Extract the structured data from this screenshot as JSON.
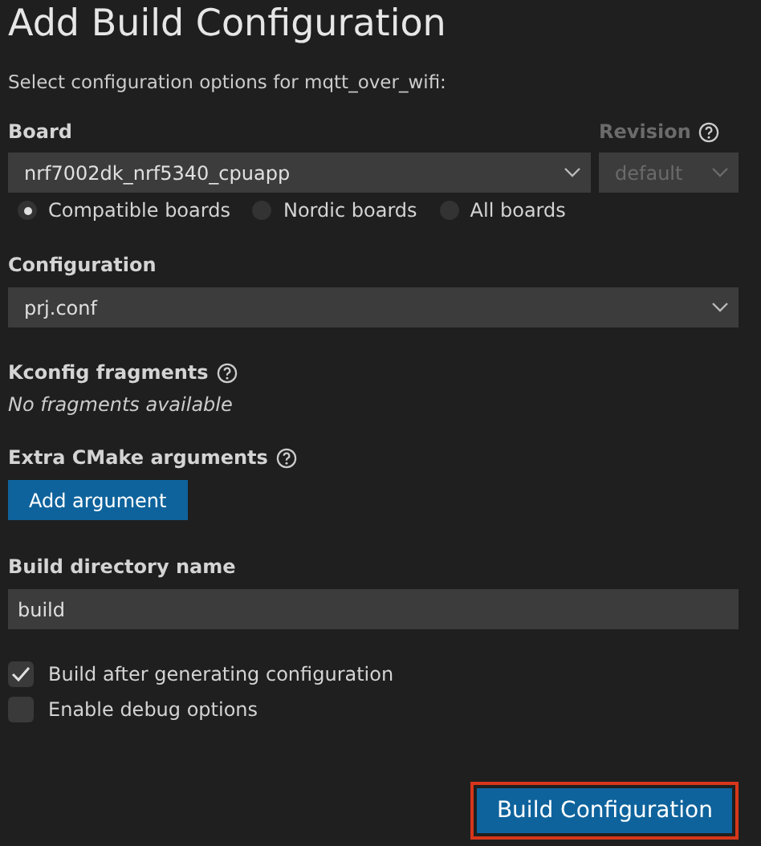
{
  "title": "Add Build Configuration",
  "subtitle": "Select configuration options for mqtt_over_wifi:",
  "board": {
    "label": "Board",
    "value": "nrf7002dk_nrf5340_cpuapp"
  },
  "revision": {
    "label": "Revision",
    "help": true,
    "value": "default",
    "disabled": true
  },
  "board_filters": [
    {
      "label": "Compatible boards",
      "selected": true
    },
    {
      "label": "Nordic boards",
      "selected": false
    },
    {
      "label": "All boards",
      "selected": false
    }
  ],
  "configuration": {
    "label": "Configuration",
    "value": "prj.conf"
  },
  "kconfig": {
    "label": "Kconfig fragments",
    "help": true,
    "empty_text": "No fragments available"
  },
  "cmake": {
    "label": "Extra CMake arguments",
    "help": true,
    "button": "Add argument"
  },
  "build_dir": {
    "label": "Build directory name",
    "value": "build"
  },
  "options": [
    {
      "label": "Build after generating configuration",
      "checked": true
    },
    {
      "label": "Enable debug options",
      "checked": false
    }
  ],
  "submit": {
    "label": "Build Configuration",
    "highlighted": true
  }
}
